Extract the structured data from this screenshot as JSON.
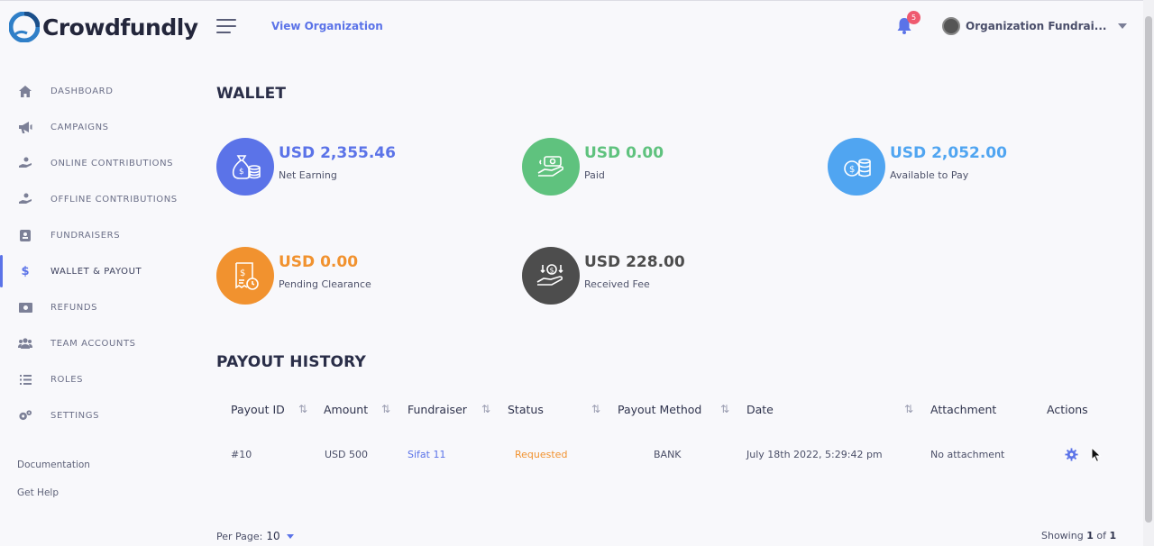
{
  "brand": {
    "name": "Crowdfundly"
  },
  "header": {
    "view_org": "View Organization",
    "notification_count": "5",
    "user_name": "Organization Fundrai..."
  },
  "sidebar": {
    "items": [
      {
        "label": "DASHBOARD",
        "icon": "home-icon"
      },
      {
        "label": "CAMPAIGNS",
        "icon": "megaphone-icon"
      },
      {
        "label": "ONLINE CONTRIBUTIONS",
        "icon": "hand-coin-icon"
      },
      {
        "label": "OFFLINE CONTRIBUTIONS",
        "icon": "hand-coin-icon"
      },
      {
        "label": "FUNDRAISERS",
        "icon": "id-card-icon"
      },
      {
        "label": "WALLET & PAYOUT",
        "icon": "dollar-icon",
        "active": true
      },
      {
        "label": "REFUNDS",
        "icon": "cash-icon"
      },
      {
        "label": "TEAM ACCOUNTS",
        "icon": "users-icon"
      },
      {
        "label": "ROLES",
        "icon": "list-icon"
      },
      {
        "label": "SETTINGS",
        "icon": "gears-icon"
      }
    ],
    "documentation": "Documentation",
    "get_help": "Get Help"
  },
  "wallet": {
    "title": "WALLET",
    "cards": [
      {
        "value": "USD 2,355.46",
        "label": "Net Earning",
        "color": "#5b73e8",
        "icon": "money-bag-icon"
      },
      {
        "value": "USD 0.00",
        "label": "Paid",
        "color": "#5fc27e",
        "icon": "hand-money-icon"
      },
      {
        "value": "USD 2,052.00",
        "label": "Available to Pay",
        "color": "#50a5f1",
        "icon": "coin-stack-icon"
      },
      {
        "value": "USD 0.00",
        "label": "Pending Clearance",
        "color": "#f1922f",
        "icon": "receipt-clock-icon"
      },
      {
        "value": "USD 228.00",
        "label": "Received Fee",
        "color": "#4d4d4d",
        "icon": "hand-coins-down-icon"
      }
    ]
  },
  "payout": {
    "title": "PAYOUT HISTORY",
    "columns": [
      "Payout ID",
      "Amount",
      "Fundraiser",
      "Status",
      "Payout Method",
      "Date",
      "Attachment",
      "Actions"
    ],
    "rows": [
      {
        "id": "#10",
        "amount": "USD 500",
        "fundraiser": "Sifat 11",
        "status": "Requested",
        "method": "BANK",
        "date": "July 18th 2022, 5:29:42 pm",
        "attachment": "No attachment"
      }
    ],
    "per_page_label": "Per Page:",
    "per_page_value": "10",
    "showing_prefix": "Showing",
    "showing_current": "1",
    "showing_of": "of",
    "showing_total": "1"
  }
}
